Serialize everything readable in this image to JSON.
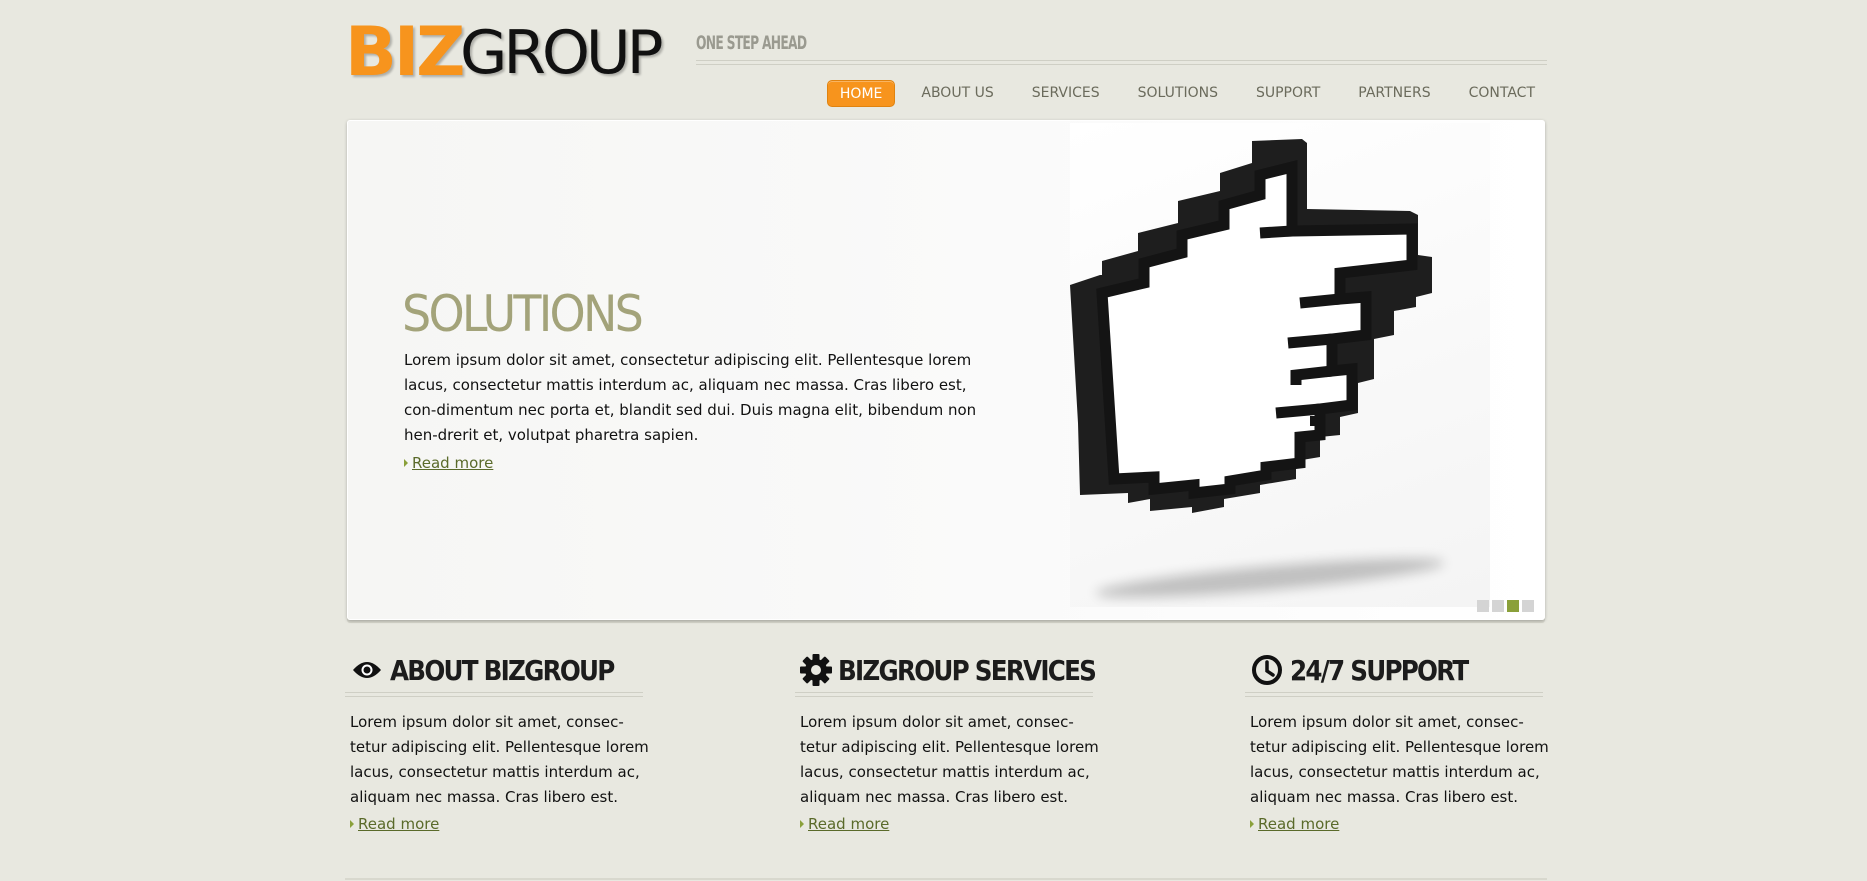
{
  "logo": {
    "part1": "BIZ",
    "part2": "GROUP"
  },
  "tagline": "ONE STEP AHEAD",
  "nav": {
    "items": [
      "HOME",
      "ABOUT US",
      "SERVICES",
      "SOLUTIONS",
      "SUPPORT",
      "PARTNERS",
      "CONTACT"
    ],
    "active": "HOME"
  },
  "slider": {
    "title": "SOLUTIONS",
    "text": "Lorem ipsum dolor sit amet, consectetur adipiscing elit. Pellentesque lorem lacus, consectetur mattis interdum ac, aliquam nec massa. Cras libero est, con-dimentum nec porta et, blandit sed dui. Duis magna elit, bibendum non hen-drerit et, volutpat pharetra sapien.",
    "read_more": "Read more",
    "image_icon": "pointing-hand-cursor-icon",
    "pager": {
      "count": 4,
      "active_index": 2
    }
  },
  "columns": [
    {
      "icon": "eye-icon",
      "title": "ABOUT BIZGROUP",
      "text": "Lorem ipsum dolor sit amet, consec-tetur adipiscing elit. Pellentesque lorem lacus, consectetur mattis interdum ac, aliquam nec massa. Cras libero est.",
      "read_more": "Read more"
    },
    {
      "icon": "gear-icon",
      "title": "BIZGROUP SERVICES",
      "text": "Lorem ipsum dolor sit amet, consec-tetur adipiscing elit. Pellentesque lorem lacus, consectetur mattis interdum ac, aliquam nec massa. Cras libero est.",
      "read_more": "Read more"
    },
    {
      "icon": "clock-icon",
      "title": "24/7 SUPPORT",
      "text": "Lorem ipsum dolor sit amet, consec-tetur adipiscing elit. Pellentesque lorem lacus, consectetur mattis interdum ac, aliquam nec massa. Cras libero est.",
      "read_more": "Read more"
    }
  ],
  "colors": {
    "accent": "#f7941d",
    "olive": "#a3a37a",
    "link": "#5a6a2a",
    "pager_active": "#8aa03a",
    "background": "#e8e8e0"
  }
}
